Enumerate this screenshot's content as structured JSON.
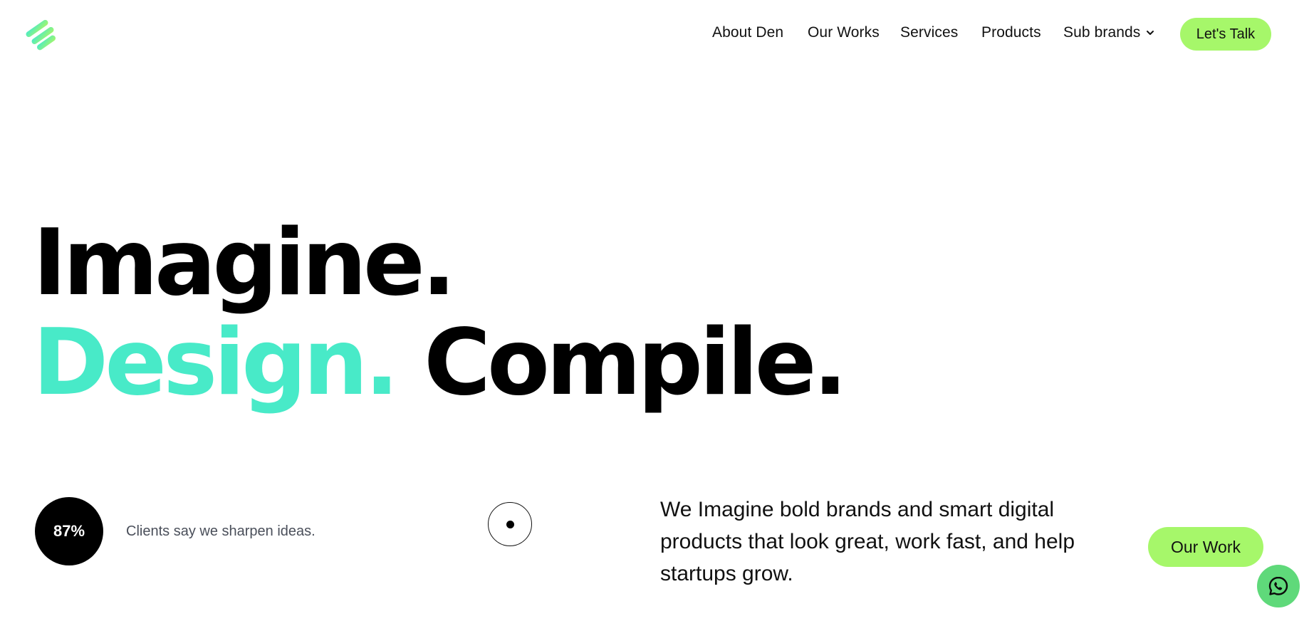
{
  "header": {
    "logo_icon": "stripes-logo-icon",
    "nav": [
      {
        "label": "About Den"
      },
      {
        "label": "Our Works"
      },
      {
        "label": "Services"
      },
      {
        "label": "Products"
      },
      {
        "label": "Sub brands",
        "icon": "chevron-down-icon"
      }
    ],
    "cta_label": "Let's Talk"
  },
  "hero": {
    "line1": "Imagine.",
    "line2_accent": "Design.",
    "line2_rest": "Compile."
  },
  "stat": {
    "value": "87%",
    "caption": "Clients say we sharpen ideas."
  },
  "intro": {
    "text": "We Imagine bold brands and smart digital products that look great, work fast, and help startups grow."
  },
  "cta_work_label": "Our Work",
  "floating": {
    "icon": "whatsapp-icon"
  },
  "colors": {
    "accent_teal": "#48eac8",
    "cta_green": "#a6f76a",
    "whatsapp_green": "#5fd97a",
    "text": "#111111",
    "muted": "#4a4f5a"
  }
}
